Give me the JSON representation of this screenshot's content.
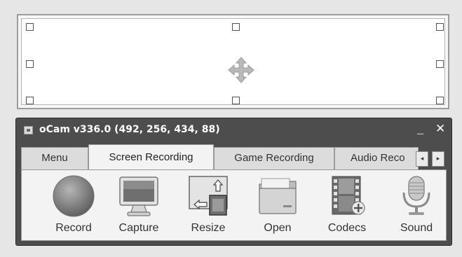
{
  "window": {
    "title": "oCam v336.0 (492, 256, 434, 88)",
    "minimize_label": "_",
    "close_label": "✕"
  },
  "tabs": [
    {
      "label": "Menu",
      "active": false
    },
    {
      "label": "Screen Recording",
      "active": true
    },
    {
      "label": "Game Recording",
      "active": false
    },
    {
      "label": "Audio Reco",
      "active": false
    }
  ],
  "tab_scroll": {
    "left": "◂",
    "right": "▸"
  },
  "toolbar": [
    {
      "label": "Record",
      "icon": "record-icon"
    },
    {
      "label": "Capture",
      "icon": "monitor-icon"
    },
    {
      "label": "Resize",
      "icon": "resize-icon"
    },
    {
      "label": "Open",
      "icon": "folder-icon"
    },
    {
      "label": "Codecs",
      "icon": "film-icon"
    },
    {
      "label": "Sound",
      "icon": "microphone-icon"
    }
  ],
  "region": {
    "move_icon": "move-arrows-icon"
  }
}
